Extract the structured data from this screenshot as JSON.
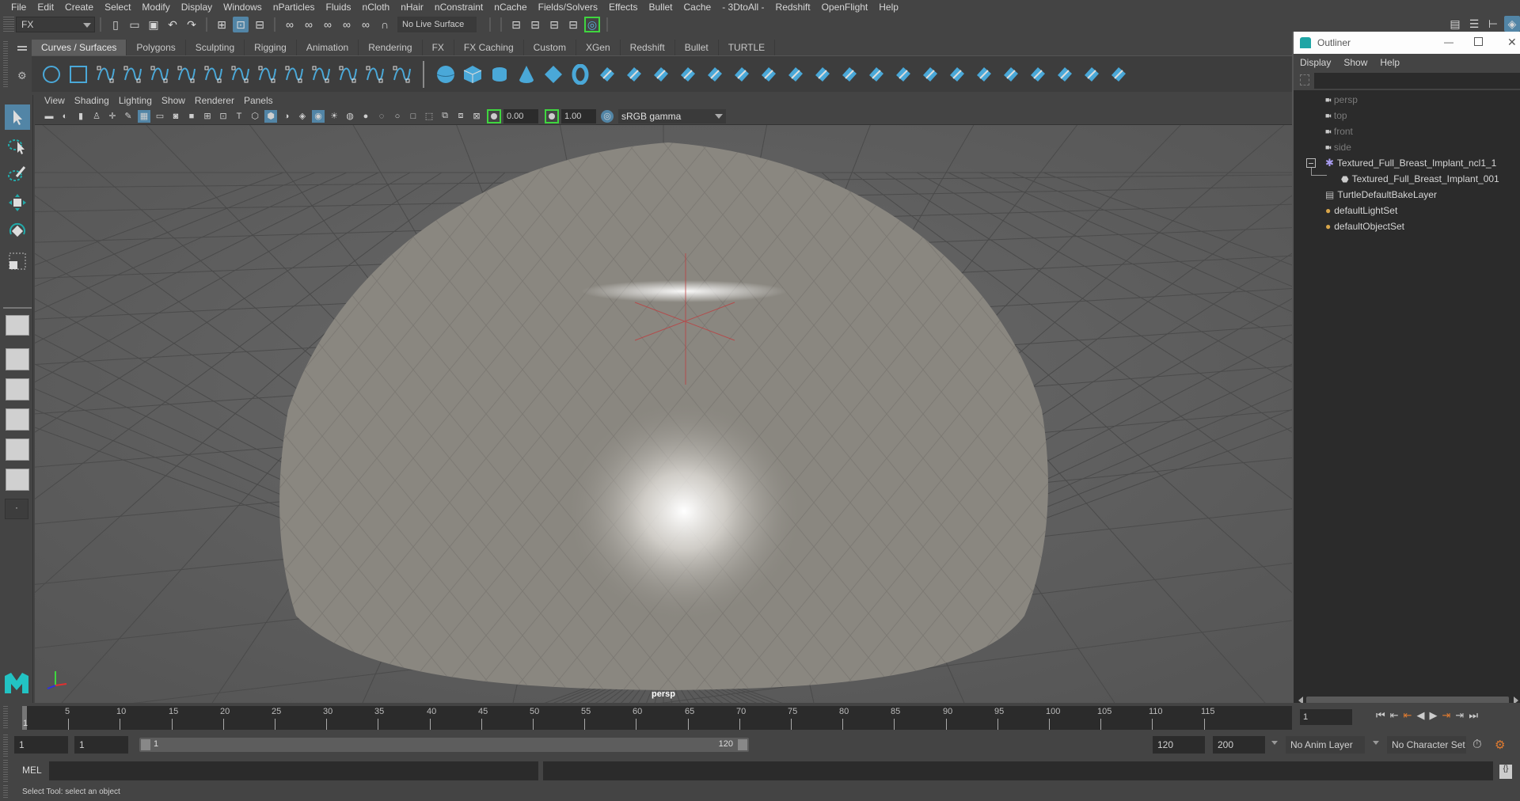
{
  "menubar": {
    "items": [
      "File",
      "Edit",
      "Create",
      "Select",
      "Modify",
      "Display",
      "Windows",
      "nParticles",
      "Fluids",
      "nCloth",
      "nHair",
      "nConstraint",
      "nCache",
      "Fields/Solvers",
      "Effects",
      "Bullet",
      "Cache",
      "- 3DtoAll -",
      "Redshift",
      "OpenFlight",
      "Help"
    ]
  },
  "statusline": {
    "menuset": "FX",
    "live_surface": "No Live Surface"
  },
  "shelf": {
    "tabs": [
      "Curves / Surfaces",
      "Polygons",
      "Sculpting",
      "Rigging",
      "Animation",
      "Rendering",
      "FX",
      "FX Caching",
      "Custom",
      "XGen",
      "Redshift",
      "Bullet",
      "TURTLE"
    ],
    "active_tab": "Curves / Surfaces",
    "curve_icons": [
      "nurbs-circle-icon",
      "nurbs-square-icon",
      "cv-curve-icon",
      "pencil-curve-icon",
      "ep-curve-icon",
      "arc-icon",
      "cut-curve-icon",
      "curve-fillet-icon",
      "extend-curve-icon",
      "offset-curve-icon",
      "rebuild-curve-icon",
      "attach-curve-icon",
      "detach-curve-icon",
      "insert-knot-icon"
    ],
    "surface_icons": [
      "nurbs-sphere-icon",
      "nurbs-cube-icon",
      "nurbs-cylinder-icon",
      "nurbs-cone-icon",
      "nurbs-plane-icon",
      "nurbs-torus-icon",
      "revolve-icon",
      "loft-icon",
      "planar-icon",
      "extrude-icon",
      "birail-icon",
      "boundary-icon",
      "square-surface-icon",
      "bevel-icon",
      "intersect-icon",
      "project-curve-icon",
      "trim-icon",
      "untrim-icon",
      "attach-surface-icon",
      "detach-surface-icon",
      "open-close-icon",
      "insert-isoparm-icon",
      "extend-surface-icon",
      "rebuild-surface-icon",
      "sculpt-icon",
      "surface-edit-icon"
    ]
  },
  "viewport": {
    "menu": [
      "View",
      "Shading",
      "Lighting",
      "Show",
      "Renderer",
      "Panels"
    ],
    "exposure": "0.00",
    "gamma": "1.00",
    "color_space": "sRGB gamma",
    "camera_label": "persp"
  },
  "outliner": {
    "title": "Outliner",
    "menu": [
      "Display",
      "Show",
      "Help"
    ],
    "items": [
      {
        "label": "persp",
        "type": "camera",
        "dim": true,
        "indent": 0
      },
      {
        "label": "top",
        "type": "camera",
        "dim": true,
        "indent": 0
      },
      {
        "label": "front",
        "type": "camera",
        "dim": true,
        "indent": 0
      },
      {
        "label": "side",
        "type": "camera",
        "dim": true,
        "indent": 0
      },
      {
        "label": "Textured_Full_Breast_Implant_ncl1_1",
        "type": "group",
        "dim": false,
        "indent": 0,
        "expanded": true
      },
      {
        "label": "Textured_Full_Breast_Implant_001",
        "type": "mesh",
        "dim": false,
        "indent": 1
      },
      {
        "label": "TurtleDefaultBakeLayer",
        "type": "bakelayer",
        "dim": false,
        "indent": 0
      },
      {
        "label": "defaultLightSet",
        "type": "set",
        "dim": false,
        "indent": 0
      },
      {
        "label": "defaultObjectSet",
        "type": "set",
        "dim": false,
        "indent": 0
      }
    ]
  },
  "timeline": {
    "ticks": [
      "5",
      "10",
      "15",
      "20",
      "25",
      "30",
      "35",
      "40",
      "45",
      "50",
      "55",
      "60",
      "65",
      "70",
      "75",
      "80",
      "85",
      "90",
      "95",
      "100",
      "105",
      "110",
      "115"
    ],
    "current_frame_marker": "1",
    "current_frame": "1"
  },
  "range": {
    "start": "1",
    "playback_start": "1",
    "slider_start": "1",
    "slider_end": "120",
    "playback_end": "120",
    "end": "200",
    "anim_layer": "No Anim Layer",
    "character_set": "No Character Set"
  },
  "mel": {
    "label": "MEL",
    "input": ""
  },
  "helpline": {
    "text": "Select Tool: select an object"
  },
  "colors": {
    "accent": "#5285a6",
    "icon_blue": "#4aa8d8",
    "viewport_bg": "#5e5e5e",
    "mesh": "#8a8780"
  }
}
